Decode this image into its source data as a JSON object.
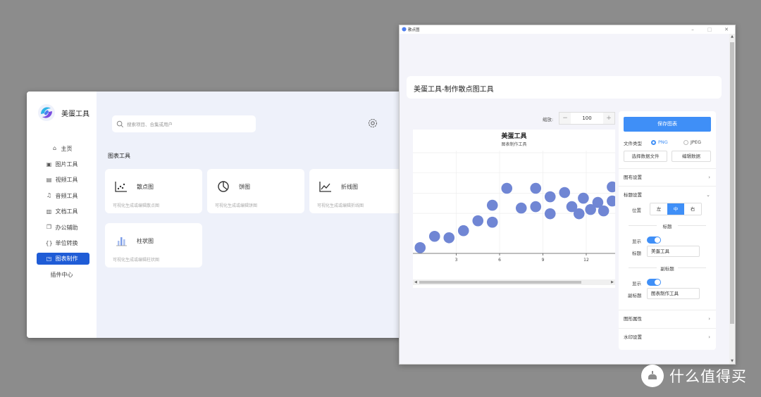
{
  "app": {
    "name": "美蛋工具",
    "nav": [
      {
        "label": "主页",
        "icon": "home-icon"
      },
      {
        "label": "图片工具",
        "icon": "image-icon"
      },
      {
        "label": "视频工具",
        "icon": "video-icon"
      },
      {
        "label": "音频工具",
        "icon": "headphones-icon"
      },
      {
        "label": "文档工具",
        "icon": "document-icon"
      },
      {
        "label": "办公辅助",
        "icon": "copy-icon"
      },
      {
        "label": "单位转换",
        "icon": "braces-icon"
      },
      {
        "label": "图表制作",
        "icon": "chart-icon"
      },
      {
        "label": "插件中心",
        "icon": ""
      }
    ],
    "active_nav": "图表制作",
    "search_placeholder": "搜索项目、合集或用户",
    "section_title": "图表工具",
    "cards": [
      {
        "title": "散点图",
        "desc": "可视化生成或编辑散点图",
        "icon": "scatter-chart-icon"
      },
      {
        "title": "饼图",
        "desc": "可视化生成或编辑饼图",
        "icon": "pie-chart-icon"
      },
      {
        "title": "折线图",
        "desc": "可视化生成或编辑折线图",
        "icon": "line-chart-icon"
      },
      {
        "title": "柱状图",
        "desc": "可视化生成或编辑柱状图",
        "icon": "bar-chart-icon"
      }
    ]
  },
  "scatter_window": {
    "window_title": "散点图",
    "heading": "美蛋工具-制作散点图工具",
    "zoom_label": "缩放:",
    "zoom_value": "100",
    "zoom_minus": "−",
    "zoom_plus": "+",
    "panel": {
      "save_button": "保存图表",
      "file_type_label": "文件类型",
      "file_type_options": [
        "PNG",
        "JPEG"
      ],
      "file_type_selected": "PNG",
      "select_data_file": "选择数据文件",
      "edit_data": "编辑数据",
      "layout_settings": "图布设置",
      "title_settings": "标题设置",
      "position_label": "位置",
      "position_options": [
        "左",
        "中",
        "右"
      ],
      "position_selected": "中",
      "title_group": "标题",
      "show_label": "显示",
      "title_label": "标题",
      "title_value": "美蛋工具",
      "title_show": true,
      "subtitle_group": "副标题",
      "subtitle_show_label": "显示",
      "subtitle_label": "副标题",
      "subtitle_value": "图表制作工具",
      "subtitle_show": true,
      "graph_props": "图形属性",
      "watermark_settings": "水印设置"
    }
  },
  "chart_data": {
    "type": "scatter",
    "title": "美蛋工具",
    "subtitle": "图表制作工具",
    "xlabel": "",
    "ylabel": "",
    "x_ticks": [
      3,
      6,
      9,
      12
    ],
    "xlim": [
      0,
      14
    ],
    "ylim": [
      0,
      12
    ],
    "grid": true,
    "color": "#7086d4",
    "points": [
      {
        "x": 0.5,
        "y": 2.4
      },
      {
        "x": 1.5,
        "y": 3.2
      },
      {
        "x": 2.5,
        "y": 3.1
      },
      {
        "x": 3.5,
        "y": 3.6
      },
      {
        "x": 4.5,
        "y": 4.3
      },
      {
        "x": 5.5,
        "y": 4.2
      },
      {
        "x": 5.5,
        "y": 5.4
      },
      {
        "x": 6.5,
        "y": 6.6
      },
      {
        "x": 7.5,
        "y": 5.2
      },
      {
        "x": 8.5,
        "y": 6.6
      },
      {
        "x": 8.5,
        "y": 5.3
      },
      {
        "x": 9.5,
        "y": 6.0
      },
      {
        "x": 9.5,
        "y": 4.8
      },
      {
        "x": 10.5,
        "y": 6.3
      },
      {
        "x": 11.0,
        "y": 5.3
      },
      {
        "x": 11.5,
        "y": 4.8
      },
      {
        "x": 11.8,
        "y": 5.9
      },
      {
        "x": 12.3,
        "y": 5.1
      },
      {
        "x": 12.8,
        "y": 5.6
      },
      {
        "x": 13.2,
        "y": 5.0
      },
      {
        "x": 13.8,
        "y": 5.7
      },
      {
        "x": 13.8,
        "y": 6.7
      }
    ]
  },
  "watermark": {
    "text": "什么值得买",
    "icon": "smzdm-logo-icon"
  }
}
